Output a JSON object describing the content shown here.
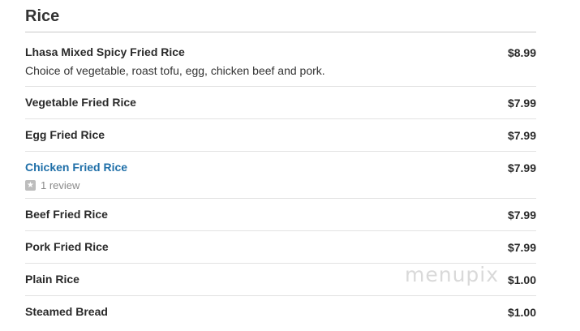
{
  "section": {
    "title": "Rice"
  },
  "items": [
    {
      "name": "Lhasa Mixed Spicy Fried Rice",
      "price": "$8.99",
      "description": "Choice of vegetable, roast tofu, egg, chicken beef and pork."
    },
    {
      "name": "Vegetable Fried Rice",
      "price": "$7.99"
    },
    {
      "name": "Egg Fried Rice",
      "price": "$7.99"
    },
    {
      "name": "Chicken Fried Rice",
      "price": "$7.99",
      "review_label": "1 review"
    },
    {
      "name": "Beef Fried Rice",
      "price": "$7.99"
    },
    {
      "name": "Pork Fried Rice",
      "price": "$7.99"
    },
    {
      "name": "Plain Rice",
      "price": "$1.00"
    },
    {
      "name": "Steamed Bread",
      "price": "$1.00"
    }
  ],
  "watermark": {
    "text": "menupix"
  },
  "colors": {
    "link": "#1f6fa8",
    "text": "#2a2a2a",
    "muted": "#8a8a8a",
    "rule": "#e2e2e2"
  },
  "icons": {
    "review": "star-icon"
  }
}
